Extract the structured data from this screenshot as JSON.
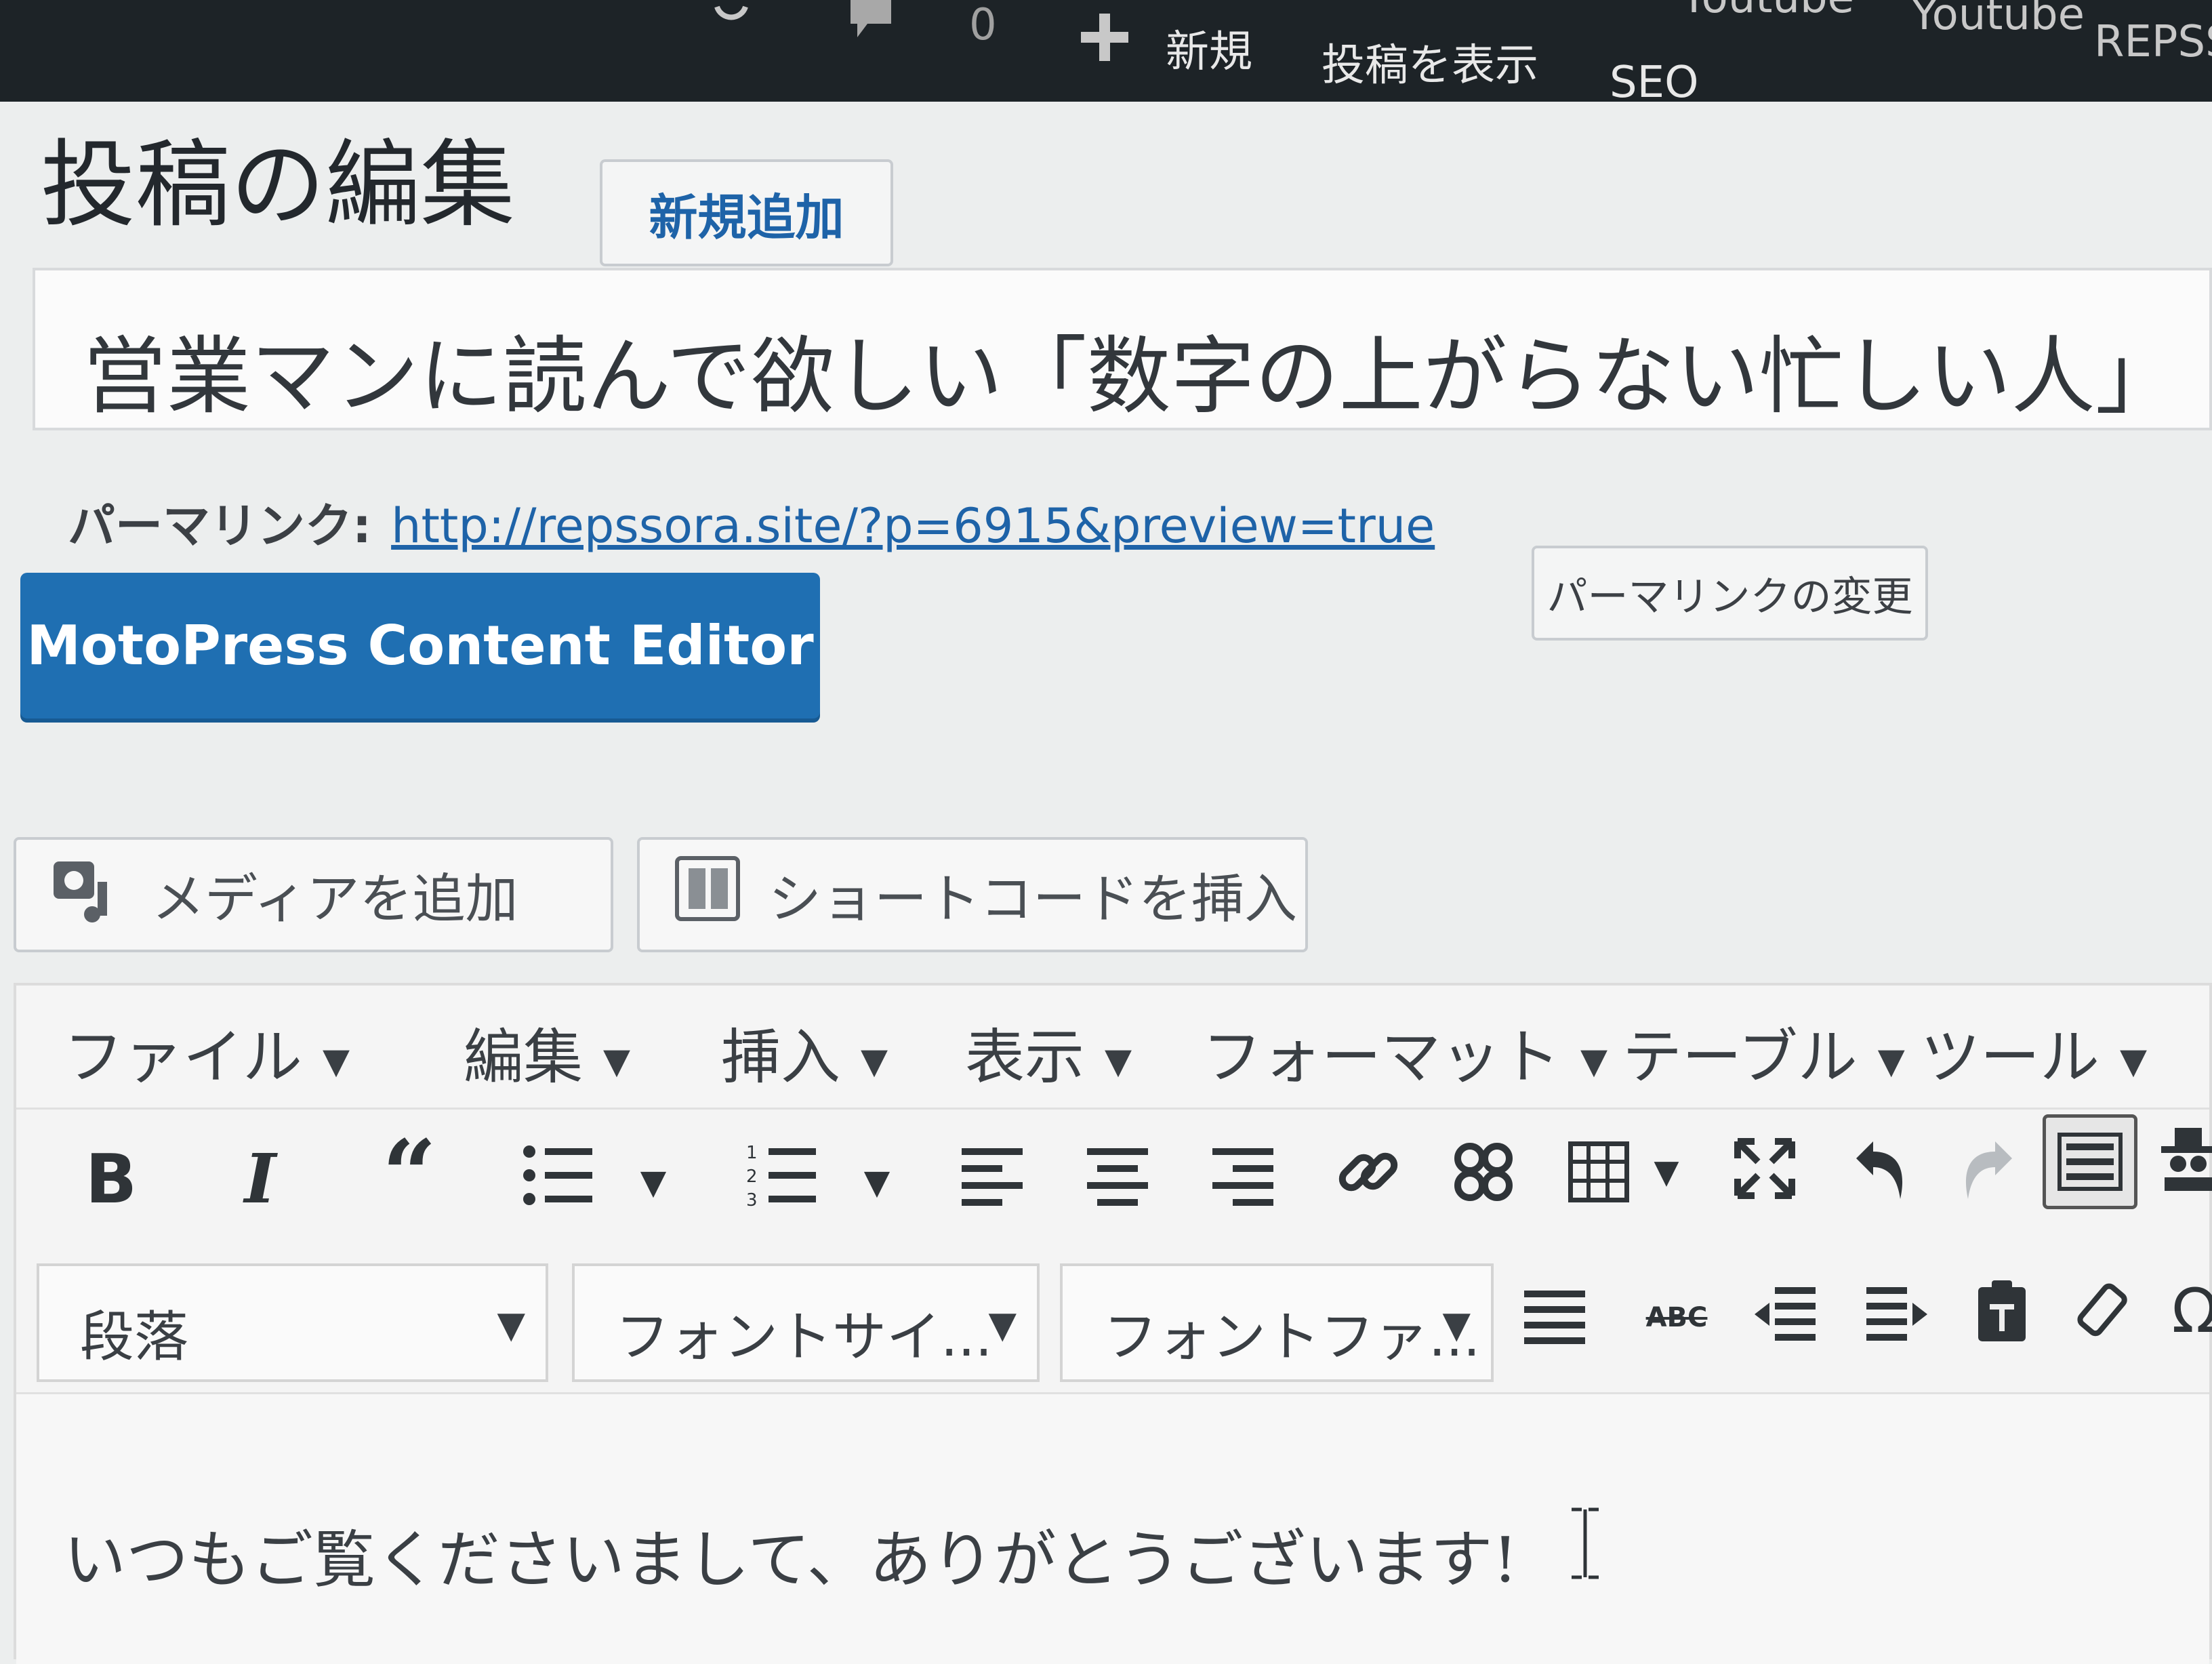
{
  "admin_bar": {
    "comment_count": "0",
    "new_label": "新規",
    "view_post_label": "投稿を表示",
    "seo_label": "SEO",
    "right_items": [
      "Youtube",
      "Youtube",
      "REPSS"
    ]
  },
  "page": {
    "title": "投稿の編集",
    "add_new_label": "新規追加"
  },
  "post": {
    "title_value": "営業マンに読んで欲しい「数字の上がらない忙しい人」",
    "permalink_label": "パーマリンク:",
    "permalink_url": "http://repssora.site/?p=6915&preview=true",
    "permalink_change_label": "パーマリンクの変更"
  },
  "motopress_label": "MotoPress Content Editor",
  "media_buttons": {
    "add_media": "メディアを追加",
    "insert_shortcode": "ショートコードを挿入"
  },
  "menubar": [
    {
      "label": "ファイル"
    },
    {
      "label": "編集"
    },
    {
      "label": "挿入"
    },
    {
      "label": "表示"
    },
    {
      "label": "フォーマット"
    },
    {
      "label": "テーブル"
    },
    {
      "label": "ツール"
    }
  ],
  "toolbar1_icons": [
    "bold-icon",
    "italic-icon",
    "blockquote-icon",
    "bullet-list-icon",
    "numbered-list-icon",
    "align-left-icon",
    "align-center-icon",
    "align-right-icon",
    "link-icon",
    "unlink-icon",
    "table-icon",
    "fullscreen-icon",
    "undo-icon",
    "redo-icon",
    "toolbar-toggle-icon",
    "spy-icon"
  ],
  "toolbar2": {
    "paragraph_select": "段落",
    "font_size_select": "フォントサイ...",
    "font_family_select": "フォントファ...",
    "icons": [
      "justify-icon",
      "strikethrough-icon",
      "outdent-icon",
      "indent-icon",
      "paste-text-icon",
      "clear-format-icon",
      "special-char-icon"
    ]
  },
  "content": {
    "text": "いつもご覧くださいまして、ありがとうございます!"
  },
  "colors": {
    "admin_bar": "#1d2327",
    "primary_button": "#1f6fb2",
    "link": "#1e63a8",
    "background": "#eceeee"
  }
}
